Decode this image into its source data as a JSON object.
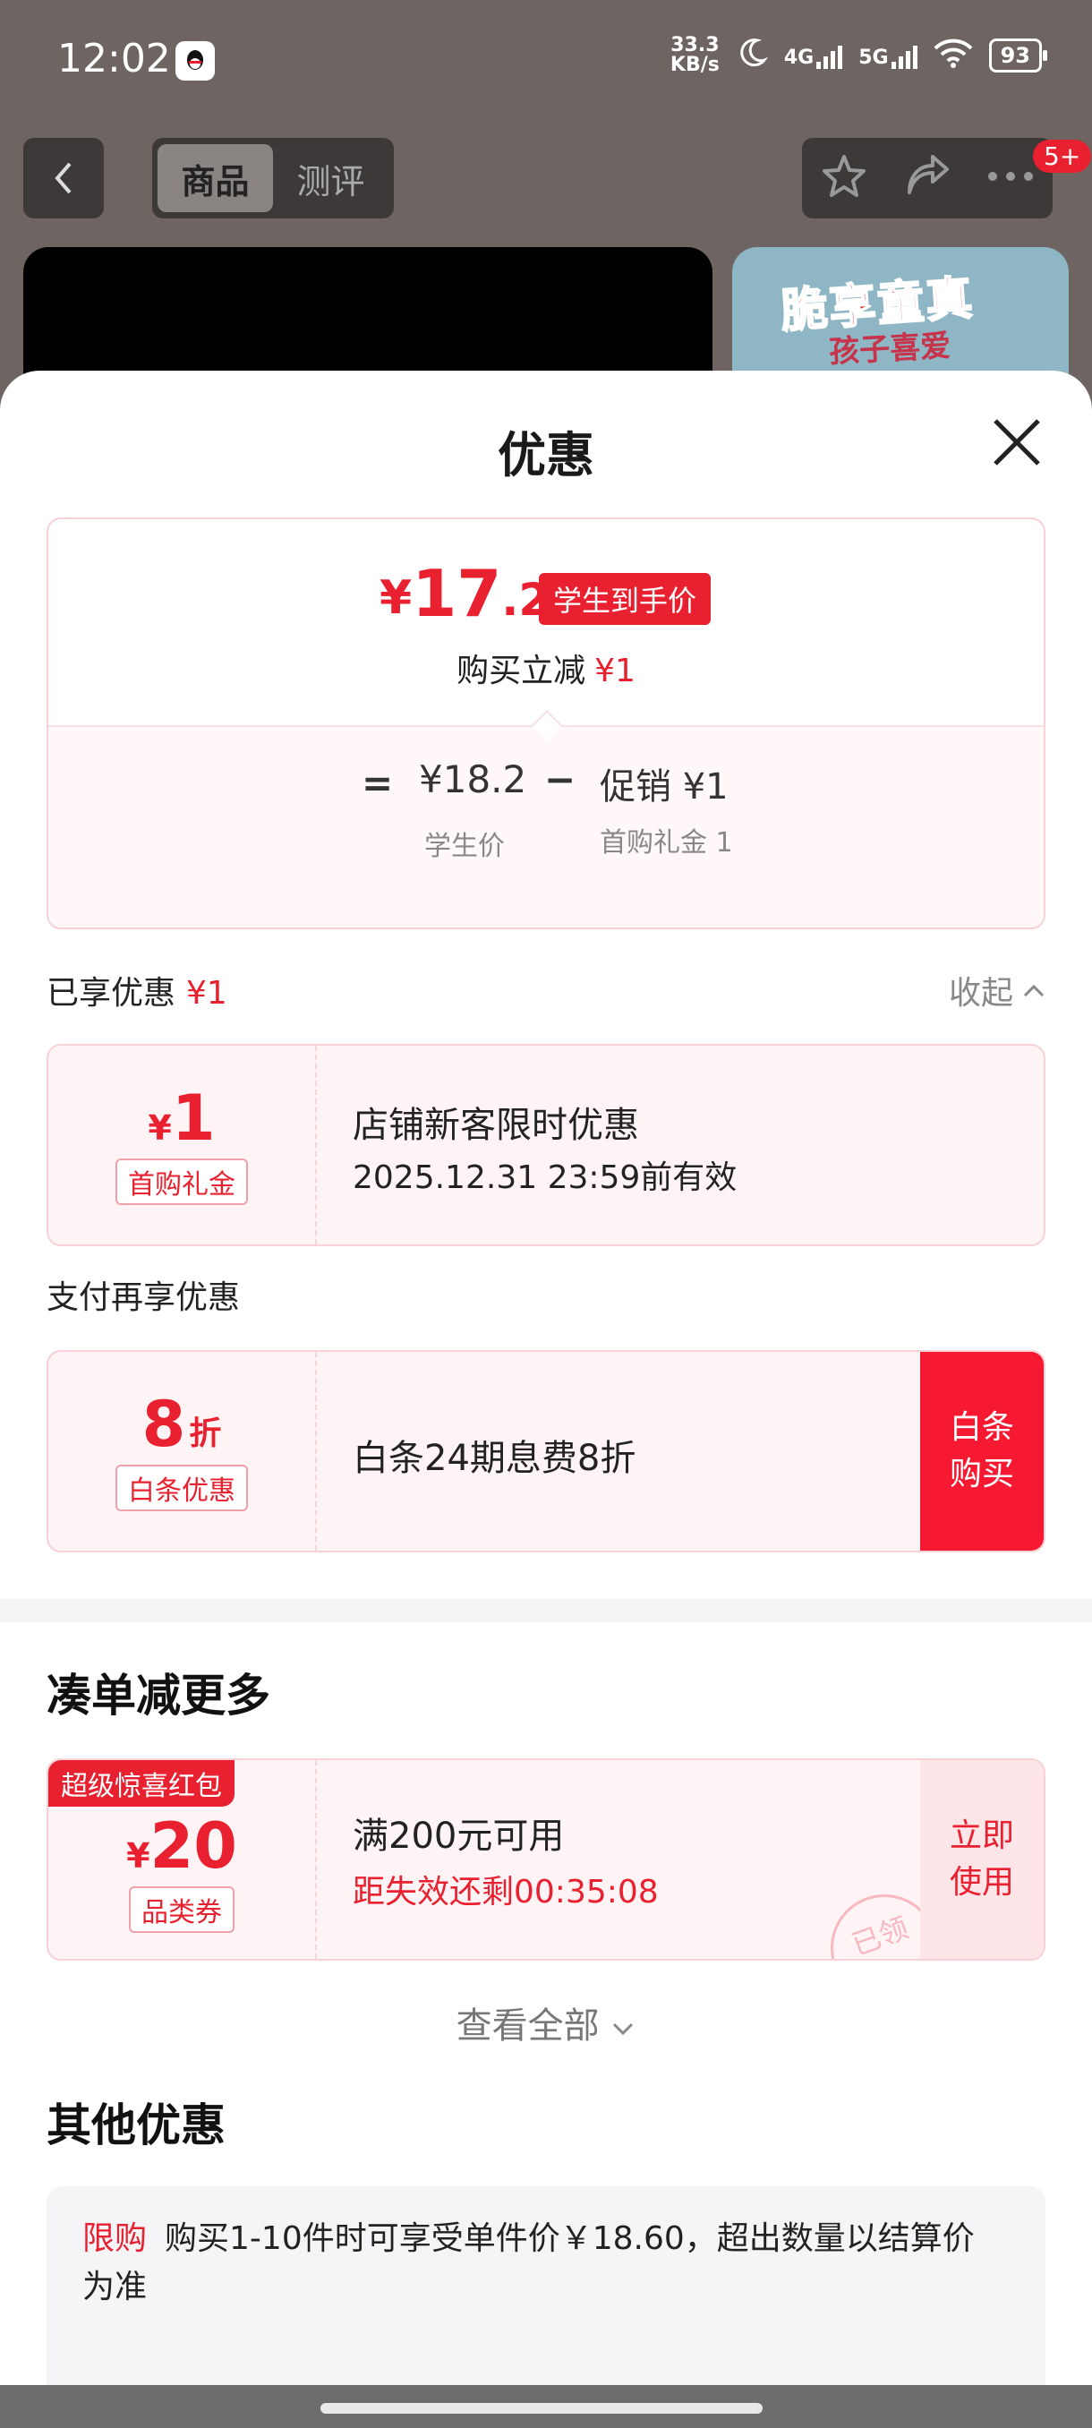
{
  "status_bar": {
    "time": "12:02",
    "speed_value": "33.3",
    "speed_unit": "KB/s",
    "net1": "4G",
    "net2": "5G",
    "battery": "93"
  },
  "top_nav": {
    "tabs": [
      "商品",
      "测评"
    ],
    "active_tab": "商品",
    "badge": "5+"
  },
  "preview": {
    "right_art_line1": "脆享童真",
    "right_art_line2": "孩子喜爱"
  },
  "sheet": {
    "title": "优惠",
    "price_summary": {
      "currency": "¥",
      "price_int": "17",
      "price_dec": ".2",
      "tag": "学生到手价",
      "sub_label": "购买立减",
      "sub_value": "¥1",
      "eq": "=",
      "base_value": "¥18.2",
      "minus": "−",
      "promo_value": "促销 ¥1",
      "base_label": "学生价",
      "promo_label": "首购礼金 1"
    },
    "enjoyed": {
      "label": "已享优惠",
      "value": "¥1",
      "collapse_label": "收起"
    },
    "coupon_first": {
      "currency": "¥",
      "amount": "1",
      "tag": "首购礼金",
      "title": "店铺新客限时优惠",
      "validity": "2025.12.31 23:59前有效"
    },
    "pay_more_label": "支付再享优惠",
    "coupon_baitiao": {
      "amount": "8",
      "unit": "折",
      "tag": "白条优惠",
      "title": "白条24期息费8折",
      "button": "白条 购买"
    },
    "bundle_section": {
      "title": "凑单减更多",
      "coupon": {
        "corner": "超级惊喜红包",
        "currency": "¥",
        "amount": "20",
        "tag": "品类券",
        "title": "满200元可用",
        "countdown": "距失效还剩00:35:08",
        "button": "立即 使用",
        "stamp": "已领"
      },
      "view_all": "查看全部"
    },
    "other_section": {
      "title": "其他优惠",
      "tag": "限购",
      "text": "购买1-10件时可享受单件价￥18.60，超出数量以结算价为准"
    }
  },
  "colors": {
    "accent": "#e8202f",
    "button_red": "#f71931",
    "coupon_bg": "#fff4f5"
  }
}
